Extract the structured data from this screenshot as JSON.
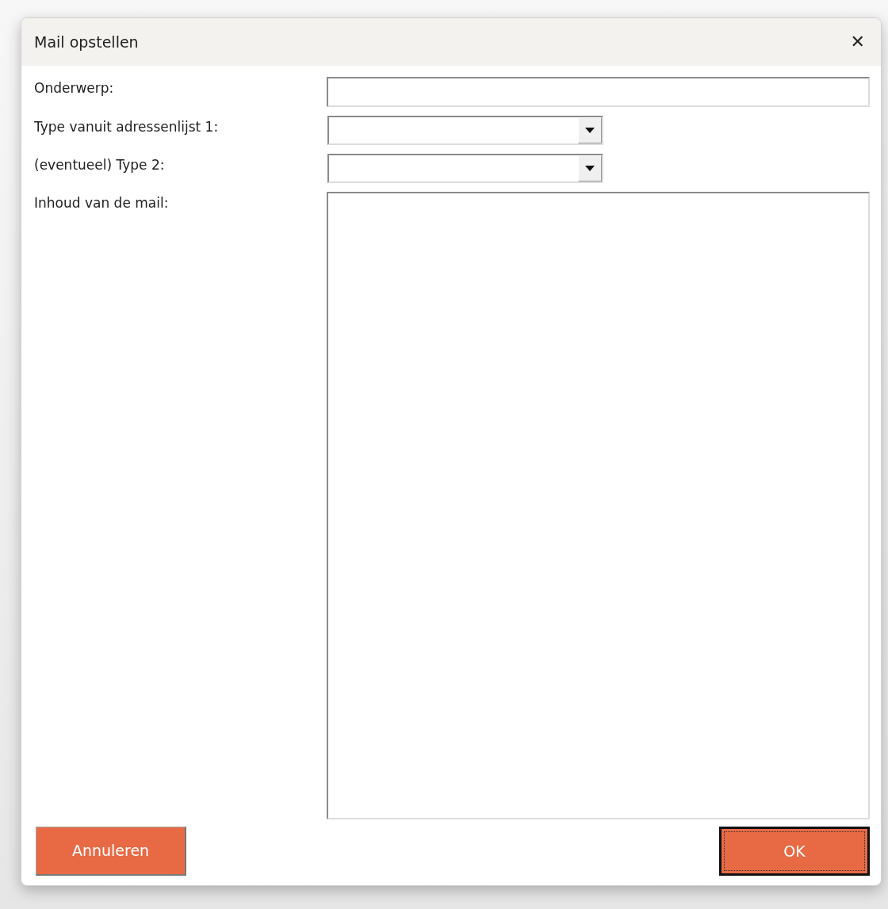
{
  "window": {
    "title": "Mail opstellen",
    "close": "✕"
  },
  "fields": [
    {
      "kind": "text",
      "label": "Onderwerp:"
    },
    {
      "kind": "combo",
      "label": "Type vanuit adressenlijst 1:"
    },
    {
      "kind": "combo",
      "label": "(eventueel) Type 2:"
    },
    {
      "kind": "memo",
      "label": "Inhoud van de mail:"
    }
  ],
  "buttons": [
    {
      "label": "Annuleren",
      "focused": false
    },
    {
      "label": "OK",
      "focused": true
    }
  ]
}
